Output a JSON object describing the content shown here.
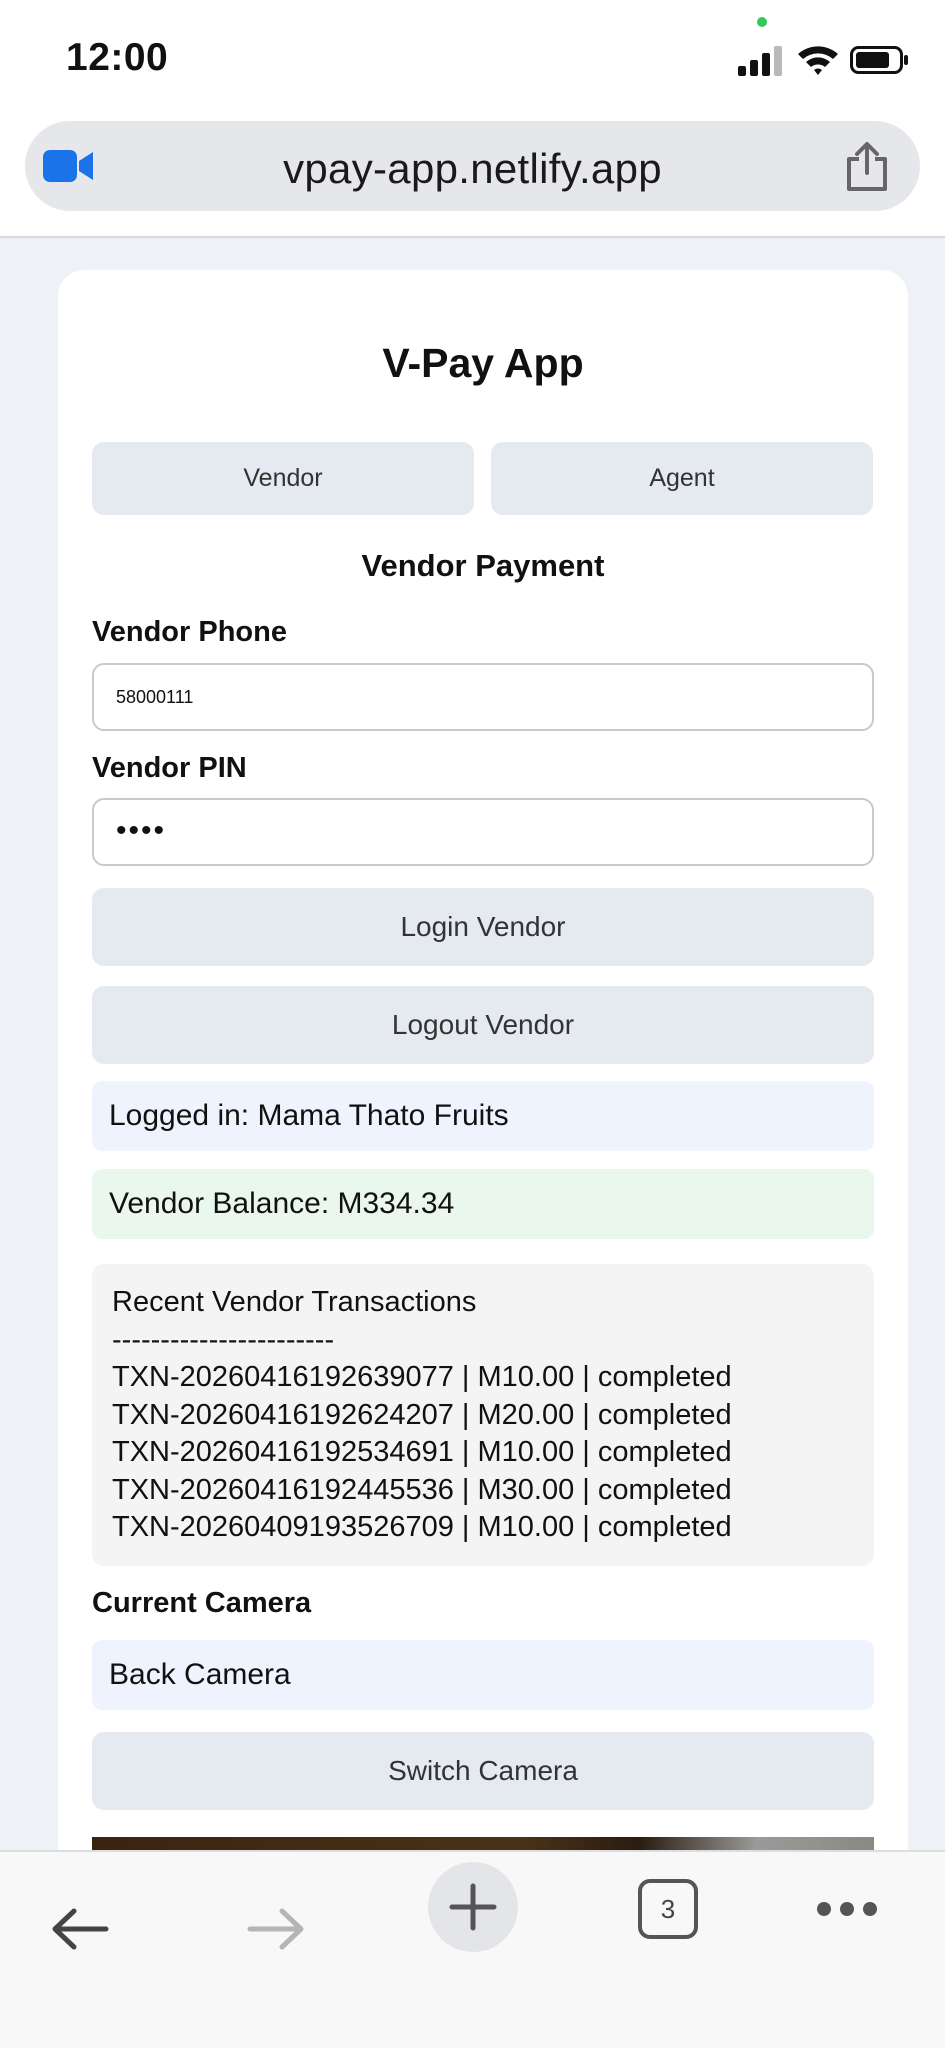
{
  "status_bar": {
    "time": "12:00",
    "icons": [
      "signal-icon",
      "wifi-icon",
      "battery-icon"
    ]
  },
  "browser": {
    "url": "vpay-app.netlify.app",
    "tab_count": "3"
  },
  "app": {
    "title": "V-Pay App",
    "tabs": [
      {
        "label": "Vendor"
      },
      {
        "label": "Agent"
      }
    ],
    "section_title": "Vendor Payment",
    "vendor_phone": {
      "label": "Vendor Phone",
      "value": "58000111"
    },
    "vendor_pin": {
      "label": "Vendor PIN",
      "value": "••••"
    },
    "login_button": "Login Vendor",
    "logout_button": "Logout Vendor",
    "logged_in_text": "Logged in: Mama Thato Fruits",
    "balance_text": "Vendor Balance: M334.34",
    "transactions": {
      "title": "Recent Vendor Transactions",
      "separator": "-----------------------",
      "rows": [
        "TXN-20260416192639077 | M10.00 | completed",
        "TXN-20260416192624207 | M20.00 | completed",
        "TXN-20260416192534691 | M10.00 | completed",
        "TXN-20260416192445536 | M30.00 | completed",
        "TXN-20260409193526709 | M10.00 | completed"
      ]
    },
    "camera": {
      "label": "Current Camera",
      "current": "Back Camera",
      "switch_button": "Switch Camera"
    }
  },
  "colors": {
    "page_bg": "#eef1f5",
    "button_bg": "#e5e9f0",
    "info_blue": "#eef3fd",
    "info_green": "#eaf7ec",
    "privacy_dot": "#34c759",
    "camera_icon": "#1a73e8"
  }
}
